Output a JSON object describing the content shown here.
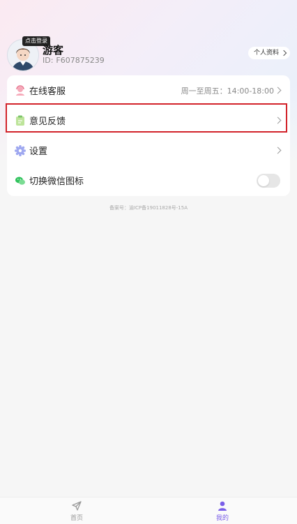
{
  "profile": {
    "login_tag": "点击登录",
    "nickname": "游客",
    "id_label": "ID:",
    "id_value": "F607875239",
    "profile_link": "个人资料"
  },
  "menu": [
    {
      "label": "在线客服",
      "right_text": "周一至周五：14:00-18:00",
      "icon": "customer-service-icon"
    },
    {
      "label": "意见反馈",
      "icon": "feedback-icon"
    },
    {
      "label": "设置",
      "icon": "settings-icon"
    },
    {
      "label": "切换微信图标",
      "icon": "wechat-icon",
      "toggle": false
    }
  ],
  "footer": {
    "icp": "备案号：渝ICP备19011828号-15A"
  },
  "tabs": [
    {
      "label": "首页",
      "icon": "send-icon",
      "active": false
    },
    {
      "label": "我的",
      "icon": "user-icon",
      "active": true
    }
  ],
  "colors": {
    "accent": "#7a5ee8",
    "highlight": "#d2232a"
  }
}
